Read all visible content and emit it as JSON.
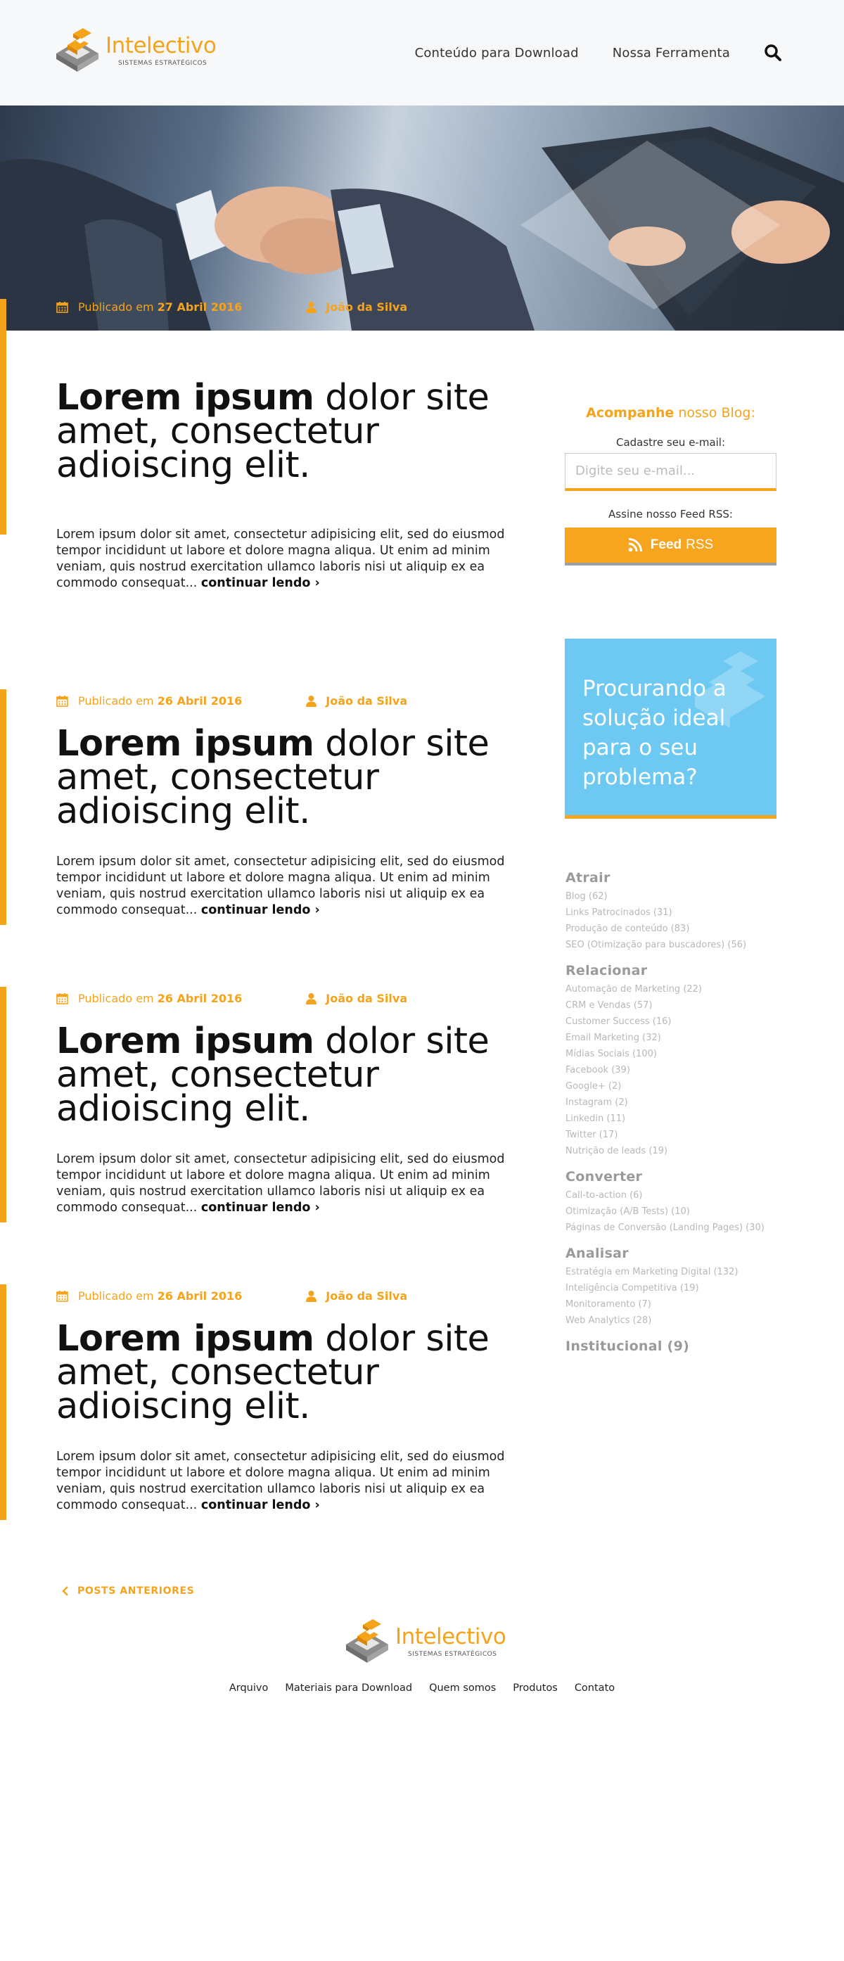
{
  "brand": {
    "name": "Intelectivo",
    "tagline": "SISTEMAS ESTRATÉGICOS",
    "color": "#f5a31a"
  },
  "nav": {
    "items": [
      "Conteúdo para Download",
      "Nossa Ferramenta"
    ],
    "search_icon": "search-icon"
  },
  "hero": {
    "published_label": "Publicado em",
    "date": "27 Abril 2016",
    "author": "João da Silva"
  },
  "posts": [
    {
      "title_bold": "Lorem ipsum",
      "title_rest": "dolor site amet, consectetur adioiscing elit.",
      "excerpt": "Lorem ipsum dolor sit amet, consectetur adipisicing elit, sed do eiusmod tempor incididunt ut labore et dolore magna aliqua. Ut enim ad minim veniam, quis nostrud exercitation ullamco laboris nisi ut aliquip ex ea commodo consequat...",
      "more": "continuar lendo ›"
    },
    {
      "published_label": "Publicado em",
      "date": "26 Abril 2016",
      "author": "João da Silva",
      "title_bold": "Lorem ipsum",
      "title_rest": "dolor site amet, consectetur adioiscing elit.",
      "excerpt": "Lorem ipsum dolor sit amet, consectetur adipisicing elit, sed do eiusmod tempor incididunt ut labore et dolore magna aliqua. Ut enim ad minim veniam, quis nostrud exercitation ullamco laboris nisi ut aliquip ex ea commodo consequat...",
      "more": "continuar lendo ›"
    },
    {
      "published_label": "Publicado em",
      "date": "26 Abril 2016",
      "author": "João da Silva",
      "title_bold": "Lorem ipsum",
      "title_rest": "dolor site amet, consectetur adioiscing elit.",
      "excerpt": "Lorem ipsum dolor sit amet, consectetur adipisicing elit, sed do eiusmod tempor incididunt ut labore et dolore magna aliqua. Ut enim ad minim veniam, quis nostrud exercitation ullamco laboris nisi ut aliquip ex ea commodo consequat...",
      "more": "continuar lendo ›"
    },
    {
      "published_label": "Publicado em",
      "date": "26 Abril 2016",
      "author": "João da Silva",
      "title_bold": "Lorem ipsum",
      "title_rest": "dolor site amet, consectetur adioiscing elit.",
      "excerpt": "Lorem ipsum dolor sit amet, consectetur adipisicing elit, sed do eiusmod tempor incididunt ut labore et dolore magna aliqua. Ut enim ad minim veniam, quis nostrud exercitation ullamco laboris nisi ut aliquip ex ea commodo consequat...",
      "more": "continuar lendo ›"
    }
  ],
  "sidebar": {
    "subscribe_bold": "Acompanhe",
    "subscribe_rest": "nosso Blog:",
    "email_label": "Cadastre seu e-mail:",
    "email_placeholder": "Digite seu e-mail...",
    "rss_label": "Assine nosso Feed RSS:",
    "feed_bold": "Feed",
    "feed_rest": "RSS",
    "promo_text": "Procurando a solução ideal para o seu problema?",
    "categories": [
      {
        "title": "Atrair",
        "items": [
          "Blog (62)",
          "Links Patrocinados (31)",
          "Produção de conteúdo (83)",
          "SEO (Otimização para buscadores) (56)"
        ]
      },
      {
        "title": "Relacionar",
        "items": [
          "Automação de Marketing (22)",
          "CRM e Vendas (57)",
          "Customer Success (16)",
          "Email Marketing (32)",
          "Mídias Sociais (100)",
          "Facebook (39)",
          "Google+ (2)",
          "Instagram (2)",
          "Linkedin (11)",
          "Twitter (17)",
          "Nutrição de leads (19)"
        ]
      },
      {
        "title": "Converter",
        "items": [
          "Call-to-action (6)",
          "Otimização (A/B Tests) (10)",
          "Páginas de Conversão (Landing Pages) (30)"
        ]
      },
      {
        "title": "Analisar",
        "items": [
          "Estratégia em Marketing Digital (132)",
          "Inteligência Competitiva (19)",
          "Monitoramento (7)",
          "Web Analytics (28)"
        ]
      },
      {
        "title": "Institucional (9)",
        "items": []
      }
    ]
  },
  "pagination": {
    "prev_label": "POSTS ANTERIORES"
  },
  "footer": {
    "links": [
      "Arquivo",
      "Materiais para Download",
      "Quem somos",
      "Produtos",
      "Contato"
    ]
  }
}
